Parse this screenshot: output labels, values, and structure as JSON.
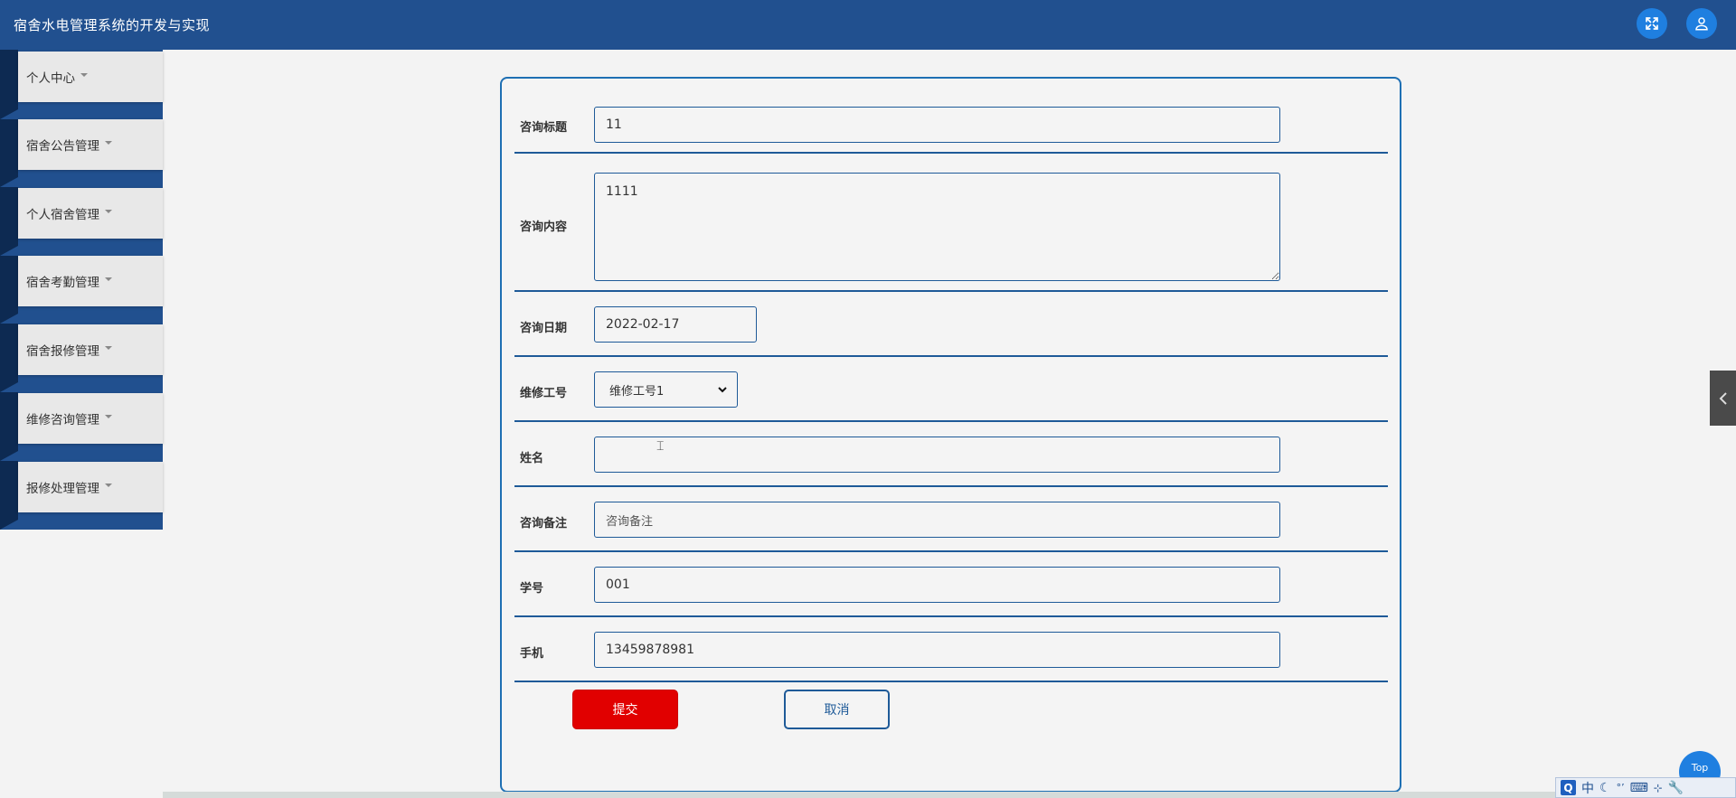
{
  "header": {
    "title": "宿舍水电管理系统的开发与实现",
    "fullscreen_icon": "expand-icon",
    "user_icon": "user-icon"
  },
  "sidebar": {
    "items": [
      {
        "label": "个人中心"
      },
      {
        "label": "宿舍公告管理"
      },
      {
        "label": "个人宿舍管理"
      },
      {
        "label": "宿舍考勤管理"
      },
      {
        "label": "宿舍报修管理"
      },
      {
        "label": "维修咨询管理"
      },
      {
        "label": "报修处理管理"
      }
    ]
  },
  "form": {
    "title": {
      "label": "咨询标题",
      "value": "11"
    },
    "content": {
      "label": "咨询内容",
      "value": "1111"
    },
    "date": {
      "label": "咨询日期",
      "value": "2022-02-17"
    },
    "worker_id": {
      "label": "维修工号",
      "value": "维修工号1"
    },
    "name": {
      "label": "姓名",
      "value": ""
    },
    "remark": {
      "label": "咨询备注",
      "placeholder": "咨询备注"
    },
    "student_id": {
      "label": "学号",
      "value": "001"
    },
    "phone": {
      "label": "手机",
      "value": "13459878981"
    },
    "submit_label": "提交",
    "cancel_label": "取消"
  },
  "top_button": {
    "label": "Top"
  },
  "ime": {
    "mode": "中"
  },
  "colors": {
    "header": "#21508f",
    "accent_blue": "#1f7fe0",
    "submit_red": "#e10000",
    "border_blue": "#1e5a98"
  }
}
